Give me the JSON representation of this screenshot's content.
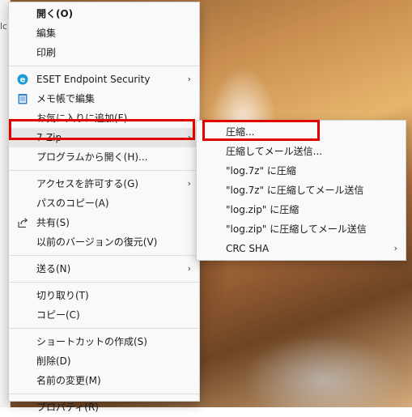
{
  "main_menu": {
    "items": [
      {
        "label": "開く(O)",
        "bold": true
      },
      {
        "label": "編集"
      },
      {
        "label": "印刷"
      },
      {
        "label": "ESET Endpoint Security",
        "icon": "eset-icon",
        "submenu": true
      },
      {
        "label": "メモ帳で編集",
        "icon": "notepad-icon"
      },
      {
        "label": "お気に入りに追加(F)"
      },
      {
        "label": "7-Zip",
        "submenu": true,
        "highlighted": true
      },
      {
        "label": "プログラムから開く(H)..."
      },
      {
        "label": "アクセスを許可する(G)",
        "submenu": true
      },
      {
        "label": "パスのコピー(A)"
      },
      {
        "label": "共有(S)",
        "icon": "share-icon"
      },
      {
        "label": "以前のバージョンの復元(V)"
      },
      {
        "label": "送る(N)",
        "submenu": true
      },
      {
        "label": "切り取り(T)"
      },
      {
        "label": "コピー(C)"
      },
      {
        "label": "ショートカットの作成(S)"
      },
      {
        "label": "削除(D)"
      },
      {
        "label": "名前の変更(M)"
      },
      {
        "label": "プロパティ(R)"
      }
    ],
    "arrow_glyph": "›"
  },
  "sub_menu": {
    "items": [
      {
        "label": "圧縮..."
      },
      {
        "label": "圧縮してメール送信..."
      },
      {
        "label": "\"log.7z\" に圧縮"
      },
      {
        "label": "\"log.7z\" に圧縮してメール送信"
      },
      {
        "label": "\"log.zip\" に圧縮"
      },
      {
        "label": "\"log.zip\" に圧縮してメール送信"
      },
      {
        "label": "CRC SHA",
        "submenu": true
      }
    ]
  },
  "window_fragment": {
    "text": "lc"
  },
  "colors": {
    "highlight_box": "#e00000",
    "eset_icon": "#1a9bd7",
    "notepad_icon": "#3b82c4"
  }
}
